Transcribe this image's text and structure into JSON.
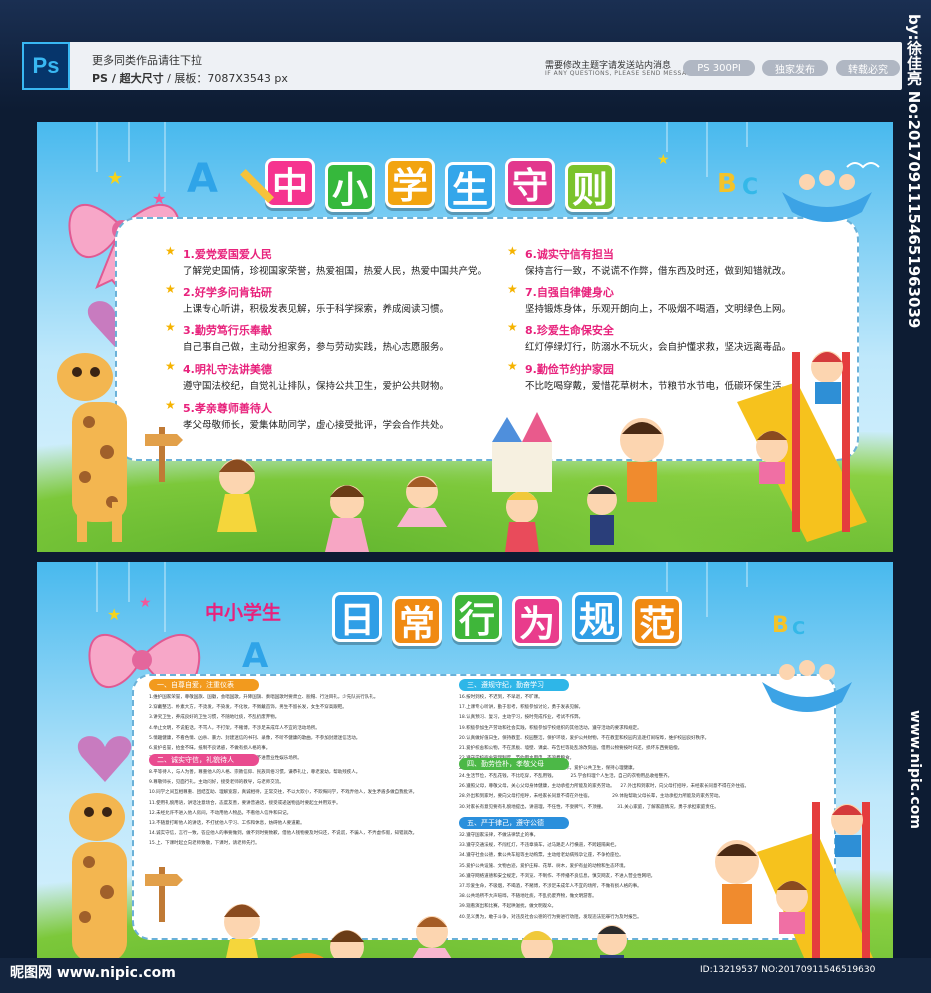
{
  "header": {
    "ps_logo": "Ps",
    "more_works": "更多同类作品请往下拉",
    "format_prefix": "PS / 超大尺寸",
    "format_suffix": "  /  展板：7087X3543 px",
    "note_cn": "需要修改主题字请发送站内消息",
    "note_en": "IF ANY QUESTIONS, PLEASE SEND MESSAGE",
    "pills": [
      "PS 300PI",
      "独家发布",
      "转载必究"
    ]
  },
  "side_watermark": "by:徐佳亮 No:20170911154651963039",
  "side_watermark2": "www.nipic.com",
  "board1": {
    "title_chars": [
      "中",
      "小",
      "学",
      "生",
      "守",
      "则"
    ],
    "title_colors": [
      "#f6348f",
      "#36b83c",
      "#f2a410",
      "#33a6ea",
      "#e2378d",
      "#7bc32c"
    ],
    "left_rules": [
      {
        "head": "1.爱党爱国爱人民",
        "body": "了解党史国情，珍视国家荣誉，热爱祖国，热爱人民，热爱中国共产党。"
      },
      {
        "head": "2.好学多问肯钻研",
        "body": "上课专心听讲，积极发表见解，乐于科学探索，养成阅读习惯。"
      },
      {
        "head": "3.勤劳笃行乐奉献",
        "body": "自己事自己做，主动分担家务，参与劳动实践，热心志愿服务。"
      },
      {
        "head": "4.明礼守法讲美德",
        "body": "遵守国法校纪，自觉礼让排队，保持公共卫生，爱护公共财物。"
      },
      {
        "head": "5.孝亲尊师善待人",
        "body": "孝父母敬师长，爱集体助同学，虚心接受批评，学会合作共处。"
      }
    ],
    "right_rules": [
      {
        "head": "6.诚实守信有担当",
        "body": "保持言行一致，不说谎不作弊，借东西及时还，做到知错就改。"
      },
      {
        "head": "7.自强自律健身心",
        "body": "坚持锻炼身体，乐观开朗向上，不吸烟不喝酒，文明绿色上网。"
      },
      {
        "head": "8.珍爱生命保安全",
        "body": "红灯停绿灯行，防溺水不玩火，会自护懂求救，坚决远离毒品。"
      },
      {
        "head": "9.勤俭节约护家园",
        "body": "不比吃喝穿戴，爱惜花草树木，节粮节水节电，低碳环保生活。"
      }
    ]
  },
  "board2": {
    "subtitle": "中小学生",
    "title_chars": [
      "日",
      "常",
      "行",
      "为",
      "规",
      "范"
    ],
    "title_colors": [
      "#2f9ee6",
      "#f08a12",
      "#3fb63a",
      "#e93c8c",
      "#2f9ee6",
      "#f08a12"
    ],
    "left_sections": [
      {
        "head": "一、自尊自爱，注重仪表",
        "lines": "1.维护国家荣誉，尊敬国旗、国徽，会唱国歌，升降国旗、奏唱国歌时要肃立、脱帽、行注目礼，少先队员行队礼。\n2.穿戴整洁、朴素大方，不烫发，不染发，不化妆，不佩戴首饰，男生不留长发，女生不穿高跟鞋。\n3.讲究卫生，养成良好的卫生习惯，不随地吐痰，不乱扔废弃物。\n4.举止文明，不说脏话，不骂人，不打架，不赌博，不涉足未成年人不宜的活动场所。\n5.情趣健康，不看色情、凶杀、暴力、封建迷信的书刊、录像，不听不健康的歌曲，不参加封建迷信活动。\n6.爱护名誉，拾金不昧，抵制不良诱惑，不做有损人格的事。\n7.注意安全，放学按时回家，不在外逗留，不骑快车，不进营业性娱乐场所。"
      },
      {
        "head": "二、诚实守信，礼貌待人",
        "lines": "8.平等待人，与人为善，尊重他人的人格、宗教信仰、民族风俗习惯，谦恭礼让，尊老爱幼，帮助残疾人。\n9.尊敬师长，见面行礼，主动问好，接受老师的教导，与老师交流。\n10.同学之间互相尊重、团结互助、理解宽容，真诚相待，正常交往，不以大欺小，不欺侮同学，不戏弄他人，发生矛盾多做自我批评。\n11.使用礼貌用语，讲话注意场合，态度友善，要讲普通话，接受或递送物品时要起立并用双手。\n12.未经允许不进入他人房间，不动用他人物品，不看他人信件和日记。\n13.不随意打断他人的讲话，不打扰他人学习、工作和休息，妨碍他人要道歉。\n14.诚实守信，言行一致，答应他人的事要做到，做不到时要致歉，借他人钱物要及时归还，不说谎，不骗人，不弄虚作假，知错就改。\n15.上、下课时起立向老师致敬，下课时，请老师先行。"
      }
    ],
    "right_sections": [
      {
        "head": "三、遵规守纪，勤奋学习",
        "lines": "16.按时到校，不迟到，不早退，不旷课。\n17.上课专心听讲，勤于思考，积极参加讨论，勇于发表见解。\n18.认真预习、复习，主动学习，按时完成作业，考试不作弊。\n19.积极参加生产劳动和社会实践，积极参加学校组织的其他活动，遵守活动的要求和规定。\n20.认真做好值日生，保持教室、校园整洁，保护环境，爱护公共财物，不在教室和校园内追逐打闹喧哗，维护校园良好秩序。\n21.爱护校舍和公物，不在黑板、墙壁、课桌、布告栏等处乱涂改刻画，借用公物要按时归还，损坏东西要赔偿。\n22.遵守学校宿舍管理制度，节约用水用电，不浪费粮食。\n23.卫生习惯好，不随地吐痰，不乱扔纸屑，不损坏花木，爱护公共卫生，保持心理健康。"
      },
      {
        "head": "四、勤劳俭朴，孝敬父母",
        "lines": "24.生活节俭，不乱花钱，不比吃穿，不乱用钱。          25.学会料理个人生活，自己的衣物用品收拾整齐。\n26.遵照父母，尊敬父母，关心父母身体健康，主动承担力所能及的家务劳动。    27.外出和到家时，向父母打招呼，未经家长同意不得在外住宿。\n28.外出和到家时，要向父母打招呼，未经家长同意不得在外住宿。              29.体贴帮助父母长辈，主动承担力所能及的家务劳动。\n30.对家长有意见要有礼貌地提出，讲道理，不任性，不耍脾气，不顶撞。        31.关心家庭，了解家庭情况，勇于承担家庭责任。"
      },
      {
        "head": "五、严于律己，遵守公德",
        "lines": "32.遵守国家法律，不做法律禁止的事。\n33.遵守交通法规，不闯红灯，不违章骑车，过马路走人行横道，不跨越隔离栏。\n34.遵守社会公德，乘公共车船等主动购票，主动给老幼病残孕让座，不争抢座位。\n35.爱护公共设施、文物古迹，爱护庄稼、花草、树木，爱护有益的动物和生态环境。\n36.遵守网络道德和安全规定，不浏览、不制作、不传播不良信息，慎交网友，不进入营业性网吧。\n37.珍爱生命，不吸烟，不喝酒，不赌博，不涉足未成年人不宜的场所，不做有损人格的事。\n38.公共场所不大声喧哗，不随地吐痰，不乱扔废弃物，做文明游客。\n39.观看演出和比赛，不起哄滋扰，做文明观众。\n40.见义勇为，敢于斗争，对违反社会公德的行为要进行劝阻，发现违法犯罪行为及时报告。"
      }
    ],
    "section_colors": [
      "#f29a1e",
      "#e94b8f",
      "#2eb6e8",
      "#4cb847",
      "#2a8fdc"
    ]
  },
  "footer": {
    "site_logo": "昵图网 www.nipic.com",
    "id_text": "ID:13219537 NO:20170911546519630"
  }
}
